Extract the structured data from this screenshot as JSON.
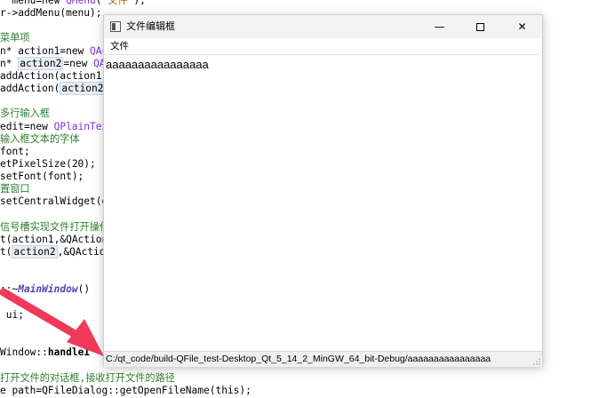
{
  "code": {
    "lines": [
      {
        "parts": [
          [
            "",
            "  menu=new "
          ],
          [
            "kw",
            "QMenu"
          ],
          [
            "",
            "(\""
          ],
          [
            "str",
            "文件"
          ],
          [
            "",
            "\");"
          ]
        ]
      },
      {
        "parts": [
          [
            "",
            "r->addMenu(menu);"
          ]
        ]
      },
      {
        "parts": [
          [
            "",
            ""
          ]
        ]
      },
      {
        "parts": [
          [
            "cm",
            "菜单项"
          ]
        ]
      },
      {
        "parts": [
          [
            "",
            "n* action1=new "
          ],
          [
            "kw",
            "QActi"
          ]
        ]
      },
      {
        "parts": [
          [
            "",
            "n* "
          ],
          [
            "hl",
            "action2"
          ],
          [
            "",
            "=new "
          ],
          [
            "kw",
            "QActi"
          ]
        ]
      },
      {
        "parts": [
          [
            "",
            "addAction(action1);"
          ]
        ]
      },
      {
        "parts": [
          [
            "",
            "addAction("
          ],
          [
            "hl",
            "action2"
          ],
          [
            "",
            ");"
          ]
        ]
      },
      {
        "parts": [
          [
            "",
            ""
          ]
        ]
      },
      {
        "parts": [
          [
            "cm",
            "多行输入框"
          ]
        ]
      },
      {
        "parts": [
          [
            "",
            "edit=new "
          ],
          [
            "kw",
            "QPlainText"
          ]
        ]
      },
      {
        "parts": [
          [
            "cm",
            "输入框文本的字体"
          ]
        ]
      },
      {
        "parts": [
          [
            "",
            "font;"
          ]
        ]
      },
      {
        "parts": [
          [
            "",
            "etPixelSize(20);"
          ]
        ]
      },
      {
        "parts": [
          [
            "",
            "setFont(font);"
          ]
        ]
      },
      {
        "parts": [
          [
            "cm",
            "置窗口"
          ]
        ]
      },
      {
        "parts": [
          [
            "",
            "setCentralWidget(ed"
          ]
        ]
      },
      {
        "parts": [
          [
            "",
            ""
          ]
        ]
      },
      {
        "parts": [
          [
            "cm",
            "信号槽实现文件打开操作"
          ]
        ]
      },
      {
        "parts": [
          [
            "",
            "t(action1,&QAction:"
          ]
        ]
      },
      {
        "parts": [
          [
            "",
            "t("
          ],
          [
            "hl",
            "action2"
          ],
          [
            "",
            ",&QAction:"
          ]
        ]
      },
      {
        "parts": [
          [
            "",
            ""
          ]
        ]
      },
      {
        "parts": [
          [
            "",
            ""
          ]
        ]
      },
      {
        "parts": [
          [
            "",
            "::~"
          ],
          [
            "it",
            "MainWindow"
          ],
          [
            "",
            "()"
          ]
        ]
      },
      {
        "parts": [
          [
            "",
            ""
          ]
        ]
      },
      {
        "parts": [
          [
            "",
            " ui;"
          ]
        ]
      },
      {
        "parts": [
          [
            "",
            ""
          ]
        ]
      },
      {
        "parts": [
          [
            "",
            ""
          ]
        ]
      },
      {
        "parts": [
          [
            "",
            "Window::"
          ],
          [
            "bold",
            "handle1"
          ]
        ]
      },
      {
        "parts": [
          [
            "",
            ""
          ]
        ]
      },
      {
        "parts": [
          [
            "cm",
            "打开文件的对话框,接收打开文件的路径"
          ]
        ]
      },
      {
        "parts": [
          [
            "",
            "e path=QFileDialog::getOpenFileName(this);"
          ]
        ]
      }
    ]
  },
  "window": {
    "title": "文件编辑框",
    "buttons": {
      "minimize": "—",
      "maximize": "",
      "close": "✕"
    },
    "icon": "app-window-icon"
  },
  "menu": {
    "items": [
      {
        "label": "文件"
      }
    ]
  },
  "editor": {
    "content": "aaaaaaaaaaaaaaaa"
  },
  "status": {
    "text": "C:/qt_code/build-QFile_test-Desktop_Qt_5_14_2_MinGW_64_bit-Debug/aaaaaaaaaaaaaaaa"
  },
  "colors": {
    "arrow": "#f03a5a"
  }
}
